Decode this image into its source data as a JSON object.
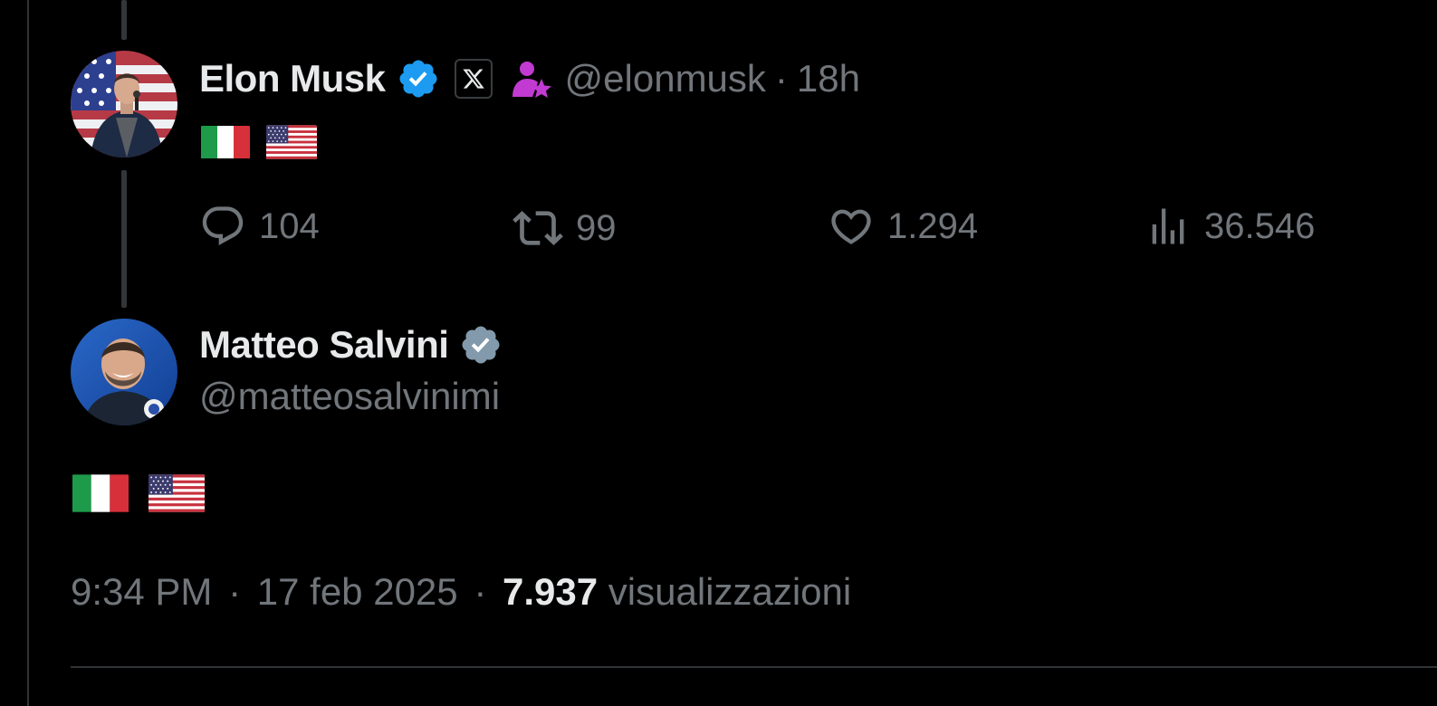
{
  "reply_tweet": {
    "author_name": "Elon Musk",
    "handle": "@elonmusk",
    "separator": "·",
    "time_ago": "18h",
    "verified_color": "#1d9bf0",
    "affiliation_icon": "x-logo-icon",
    "body_flags": [
      "flag-italy",
      "flag-usa"
    ],
    "actions": {
      "replies": "104",
      "reposts": "99",
      "likes": "1.294",
      "views": "36.546"
    }
  },
  "main_tweet": {
    "author_name": "Matteo Salvini",
    "handle": "@matteosalvinimi",
    "verified_color": "#829aab",
    "body_flags": [
      "flag-italy",
      "flag-usa"
    ],
    "time": "9:34 PM",
    "date": "17 feb 2025",
    "sep": "·",
    "views_count": "7.937",
    "views_label": "visualizzazioni"
  },
  "colors": {
    "background": "#000000",
    "text_primary": "#e7e9ea",
    "text_secondary": "#71767b",
    "subscriber_badge": "#c13ad1"
  }
}
